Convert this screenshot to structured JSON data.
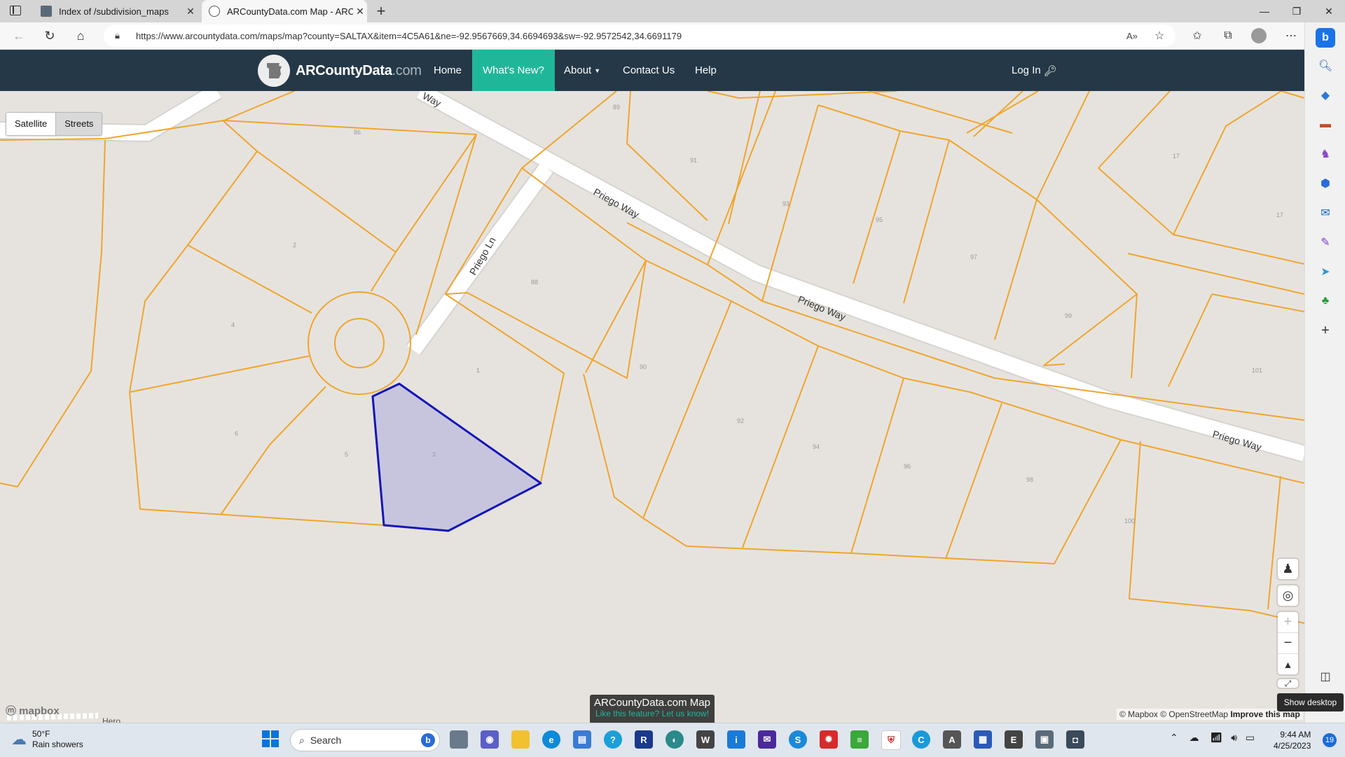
{
  "browser": {
    "tabs": [
      {
        "title": "Index of /subdivision_maps",
        "active": false
      },
      {
        "title": "ARCountyData.com Map - ARCo",
        "active": true
      }
    ],
    "new_tab_label": "+",
    "url": "https://www.arcountydata.com/maps/map?county=SALTAX&item=4C5A61&ne=-92.9567669,34.6694693&sw=-92.9572542,34.6691179"
  },
  "site": {
    "brand_main": "ARCountyData",
    "brand_suffix": ".com",
    "nav": {
      "home": "Home",
      "whats_new": "What's New?",
      "about": "About",
      "contact": "Contact Us",
      "help": "Help"
    },
    "login": "Log In",
    "accent_color": "#1fb79a",
    "navbar_color": "#243847"
  },
  "map": {
    "basemap_buttons": {
      "satellite": "Satellite",
      "streets": "Streets"
    },
    "active_basemap": "Streets",
    "streets": [
      "Way",
      "Priego Way",
      "Priego Ln",
      "Priego Way",
      "Priego Way"
    ],
    "lot_numbers": [
      "86",
      "89",
      "91",
      "93",
      "95",
      "97",
      "99",
      "101",
      "2",
      "4",
      "6",
      "5",
      "3",
      "1",
      "88",
      "90",
      "92",
      "94",
      "96",
      "98",
      "100",
      "17",
      "17"
    ],
    "parcel_outline_color": "#f0a52c",
    "selected_parcel_color": "#1515b8",
    "mapbox_logo": "mapbox",
    "attribution_1": "© Mapbox © OpenStreetMap",
    "attribution_2": "Improve this map",
    "bottom_street_fragment": "Hero...",
    "toast_title": "ARCountyData.com Map",
    "toast_link": "Like this feature? Let us know!"
  },
  "edge": {
    "show_desktop_tooltip": "Show desktop"
  },
  "taskbar": {
    "weather_temp": "50°F",
    "weather_desc": "Rain showers",
    "search_placeholder": "Search",
    "time": "9:44 AM",
    "date": "4/25/2023",
    "notification_count": "19"
  }
}
